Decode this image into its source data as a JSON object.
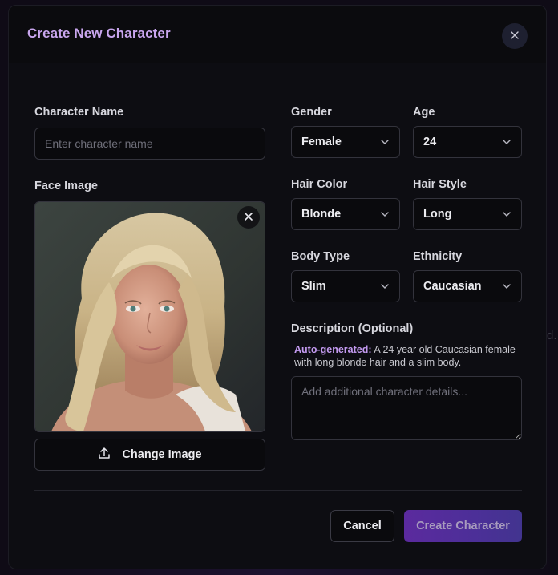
{
  "modal": {
    "title": "Create New Character",
    "close_icon": "close-icon"
  },
  "background_glyph": "d.",
  "form": {
    "character_name": {
      "label": "Character Name",
      "value": "",
      "placeholder": "Enter character name"
    },
    "face_image": {
      "label": "Face Image",
      "remove_icon": "close-icon",
      "change_button": {
        "icon": "upload-icon",
        "label": "Change Image"
      }
    },
    "gender": {
      "label": "Gender",
      "value": "Female",
      "icon": "chevron-down-icon"
    },
    "age": {
      "label": "Age",
      "value": "24",
      "icon": "chevron-down-icon"
    },
    "hair_color": {
      "label": "Hair Color",
      "value": "Blonde",
      "icon": "chevron-down-icon"
    },
    "hair_style": {
      "label": "Hair Style",
      "value": "Long",
      "icon": "chevron-down-icon"
    },
    "body_type": {
      "label": "Body Type",
      "value": "Slim",
      "icon": "chevron-down-icon"
    },
    "ethnicity": {
      "label": "Ethnicity",
      "value": "Caucasian",
      "icon": "chevron-down-icon"
    },
    "description": {
      "label": "Description (Optional)",
      "auto_label": "Auto-generated:",
      "auto_text": "A 24 year old Caucasian female with long blonde hair and a slim body.",
      "value": "",
      "placeholder": "Add additional character details..."
    }
  },
  "footer": {
    "cancel_label": "Cancel",
    "create_label": "Create Character"
  },
  "colors": {
    "accent": "#c9a6ee",
    "primary_button": "#5b2a9e",
    "panel": "#0d0d12",
    "border": "#33333c"
  }
}
